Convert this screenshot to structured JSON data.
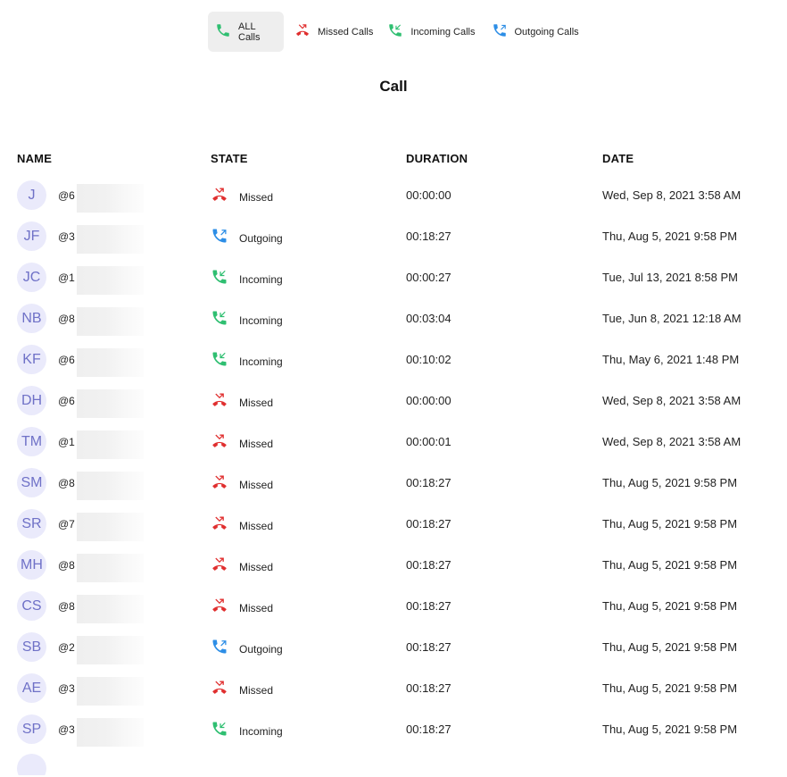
{
  "filters": {
    "tabs": [
      {
        "label": "ALL Calls",
        "icon": "phone-icon",
        "color": "#2fbf71",
        "active": true
      },
      {
        "label": "Missed Calls",
        "icon": "missed-call-icon",
        "color": "#e02f2f",
        "active": false
      },
      {
        "label": "Incoming Calls",
        "icon": "incoming-call-icon",
        "color": "#2fbf71",
        "active": false
      },
      {
        "label": "Outgoing Calls",
        "icon": "outgoing-call-icon",
        "color": "#2d8ee6",
        "active": false
      }
    ]
  },
  "page": {
    "title": "Call"
  },
  "table": {
    "headers": {
      "name": "NAME",
      "state": "STATE",
      "duration": "DURATION",
      "date": "DATE"
    },
    "rows": [
      {
        "initials": "J",
        "handle": "@6",
        "state": "Missed",
        "duration": "00:00:00",
        "date": "Wed, Sep 8, 2021 3:58 AM"
      },
      {
        "initials": "JF",
        "handle": "@3",
        "state": "Outgoing",
        "duration": "00:18:27",
        "date": "Thu, Aug 5, 2021 9:58 PM"
      },
      {
        "initials": "JC",
        "handle": "@1",
        "state": "Incoming",
        "duration": "00:00:27",
        "date": "Tue, Jul 13, 2021 8:58 PM"
      },
      {
        "initials": "NB",
        "handle": "@8",
        "state": "Incoming",
        "duration": "00:03:04",
        "date": "Tue, Jun 8, 2021 12:18 AM"
      },
      {
        "initials": "KF",
        "handle": "@6",
        "state": "Incoming",
        "duration": "00:10:02",
        "date": "Thu, May 6, 2021 1:48 PM"
      },
      {
        "initials": "DH",
        "handle": "@6",
        "state": "Missed",
        "duration": "00:00:00",
        "date": "Wed, Sep 8, 2021 3:58 AM"
      },
      {
        "initials": "TM",
        "handle": "@1",
        "state": "Missed",
        "duration": "00:00:01",
        "date": "Wed, Sep 8, 2021 3:58 AM"
      },
      {
        "initials": "SM",
        "handle": "@8",
        "state": "Missed",
        "duration": "00:18:27",
        "date": "Thu, Aug 5, 2021 9:58 PM"
      },
      {
        "initials": "SR",
        "handle": "@7",
        "state": "Missed",
        "duration": "00:18:27",
        "date": "Thu, Aug 5, 2021 9:58 PM"
      },
      {
        "initials": "MH",
        "handle": "@8",
        "state": "Missed",
        "duration": "00:18:27",
        "date": "Thu, Aug 5, 2021 9:58 PM"
      },
      {
        "initials": "CS",
        "handle": "@8",
        "state": "Missed",
        "duration": "00:18:27",
        "date": "Thu, Aug 5, 2021 9:58 PM"
      },
      {
        "initials": "SB",
        "handle": "@2",
        "state": "Outgoing",
        "duration": "00:18:27",
        "date": "Thu, Aug 5, 2021 9:58 PM"
      },
      {
        "initials": "AE",
        "handle": "@3",
        "state": "Missed",
        "duration": "00:18:27",
        "date": "Thu, Aug 5, 2021 9:58 PM"
      },
      {
        "initials": "SP",
        "handle": "@3",
        "state": "Incoming",
        "duration": "00:18:27",
        "date": "Thu, Aug 5, 2021 9:58 PM"
      }
    ]
  },
  "colors": {
    "missed": "#e02f2f",
    "incoming": "#2fbf71",
    "outgoing": "#2d8ee6",
    "avatar_bg": "#eaeafb",
    "avatar_text": "#6f71c7",
    "active_tab_bg": "#eeeeee"
  }
}
